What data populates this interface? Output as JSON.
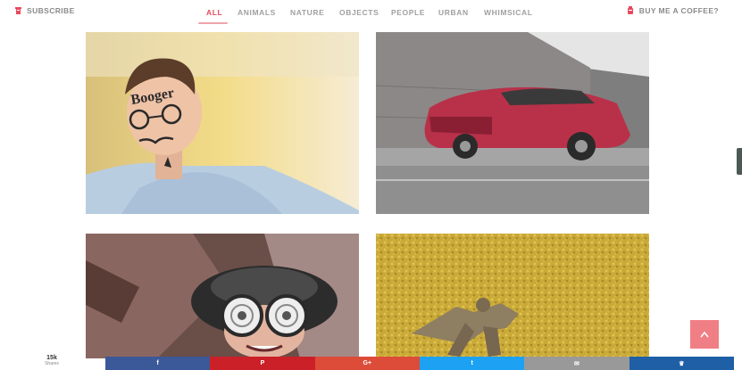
{
  "header": {
    "subscribe_label": "SUBSCRIBE",
    "coffee_label": "BUY ME A COFFEE?",
    "nav": [
      {
        "label": "ALL",
        "active": true
      },
      {
        "label": "ANIMALS",
        "active": false
      },
      {
        "label": "NATURE",
        "active": false
      },
      {
        "label": "OBJECTS",
        "active": false
      },
      {
        "label": "PEOPLE",
        "active": false
      },
      {
        "label": "URBAN",
        "active": false
      },
      {
        "label": "WHIMSICAL",
        "active": false
      }
    ]
  },
  "gallery": {
    "photos": [
      {
        "subject": "man with doodled face",
        "face_text": "Booger"
      },
      {
        "subject": "red muscle car"
      },
      {
        "subject": "person wearing bowl and goggles"
      },
      {
        "subject": "figure lying on yellow leaves"
      }
    ]
  },
  "share": {
    "count": "15k",
    "count_label": "Shares",
    "buttons": [
      {
        "network": "facebook",
        "icon": "facebook-icon",
        "glyph": "f",
        "color": "#3b5998"
      },
      {
        "network": "pinterest",
        "icon": "pinterest-icon",
        "glyph": "P",
        "color": "#cb2027"
      },
      {
        "network": "google-plus",
        "icon": "google-plus-icon",
        "glyph": "G+",
        "color": "#dd4b39"
      },
      {
        "network": "twitter",
        "icon": "twitter-icon",
        "glyph": "t",
        "color": "#1da1f2"
      },
      {
        "network": "email",
        "icon": "email-icon",
        "glyph": "✉",
        "color": "#999999"
      },
      {
        "network": "crown",
        "icon": "crown-icon",
        "glyph": "♛",
        "color": "#1e5fa6"
      }
    ]
  },
  "colors": {
    "accent": "#e8495d",
    "back_to_top": "#f07f85"
  }
}
